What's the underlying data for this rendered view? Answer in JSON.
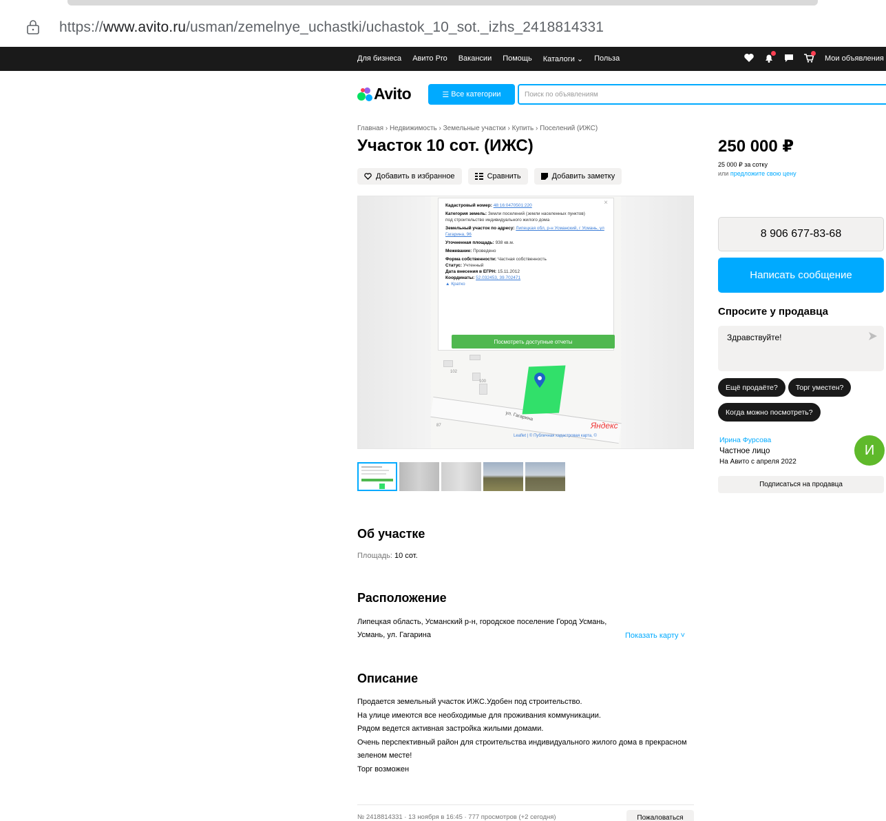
{
  "browser": {
    "url_prefix": "https://",
    "url_host": "www.avito.ru",
    "url_path": "/usman/zemelnye_uchastki/uchastok_10_sot._izhs_2418814331"
  },
  "topnav": {
    "links": [
      "Для бизнеса",
      "Авито Pro",
      "Вакансии",
      "Помощь",
      "Каталоги ⌄",
      "Польза"
    ],
    "my_ads": "Мои объявления"
  },
  "header": {
    "logo": "Avito",
    "categories_button": "Все категории",
    "search_placeholder": "Поиск по объявлениям"
  },
  "breadcrumb": "Главная › Недвижимость › Земельные участки › Купить › Поселений (ИЖС)",
  "listing": {
    "title": "Участок 10 сот. (ИЖС)",
    "actions": {
      "favorite": "Добавить в избранное",
      "compare": "Сравнить",
      "note": "Добавить заметку"
    }
  },
  "map_card": {
    "cadastral_label": "Кадастровый номер:",
    "cadastral_value": "48:16:0470501:220",
    "category_label": "Категория земель:",
    "category_value": "Земли поселений (земли населенных пунктов)",
    "category_use": "под строительство индивидуального жилого дома",
    "address_label": "Земельный участок по адресу:",
    "address_value": "Липецкая обл, р-н Усманский, г Усмань, ул Гагарина, 96",
    "area_label": "Уточненная площадь:",
    "area_value": "938 кв.м.",
    "survey_label": "Межевание:",
    "survey_value": "Проведено",
    "ownership_label": "Форма собственности:",
    "ownership_value": "Частная собственность",
    "status_label": "Статус:",
    "status_value": "Учтенный",
    "egrn_label": "Дата внесения в ЕГРН:",
    "egrn_value": "15.11.2012",
    "coords_label": "Координаты:",
    "coords_value": "52.032453, 39.702471",
    "brief": "▲ Кратко",
    "reports_button": "Посмотреть доступные отчеты",
    "street": "ул. Гагарина",
    "yandex": "Яндекс",
    "attribution": "Leaflet | © Публичная кадастровая карта, ©",
    "house_numbers": [
      "102",
      "100",
      "87"
    ]
  },
  "price": {
    "value": "250 000 ₽",
    "per_sotka": "25 000 ₽ за сотку",
    "offer_prefix": "или",
    "offer_link": "предложите свою цену"
  },
  "contact": {
    "phone": "8 906 677-83-68",
    "message_button": "Написать сообщение",
    "ask_title": "Спросите у продавца",
    "ask_text": "Здравствуйте!",
    "chips": [
      "Ещё продаёте?",
      "Торг уместен?",
      "Когда можно посмотреть?"
    ]
  },
  "seller": {
    "name": "Ирина Фурсова",
    "type": "Частное лицо",
    "since": "На Авито с апреля 2022",
    "avatar_letter": "И",
    "subscribe": "Подписаться на продавца"
  },
  "about": {
    "title": "Об участке",
    "area_label": "Площадь:",
    "area_value": "10 сот."
  },
  "location": {
    "title": "Расположение",
    "address": "Липецкая область, Усманский р-н, городское поселение Город Усмань, Усмань, ул. Гагарина",
    "show_map": "Показать карту ˅"
  },
  "description": {
    "title": "Описание",
    "lines": [
      "Продается земельный участок ИЖС.Удобен под строительство.",
      "На улице имеются все необходимые для проживания коммуникации.",
      "Рядом ведется активная застройка жилыми домами.",
      "Очень перспективный район для строительства индивидуального жилого дома в прекрасном зеленом месте!",
      "Торг возможен"
    ]
  },
  "footer": {
    "meta": "№ 2418814331 · 13 ноября в 16:45 · 777 просмотров (+2 сегодня)",
    "complain": "Пожаловаться"
  },
  "colors": {
    "accent": "#00aaff",
    "navbar": "#1a1a1a",
    "avatar": "#5fb92b",
    "plot": "#31e06a"
  }
}
